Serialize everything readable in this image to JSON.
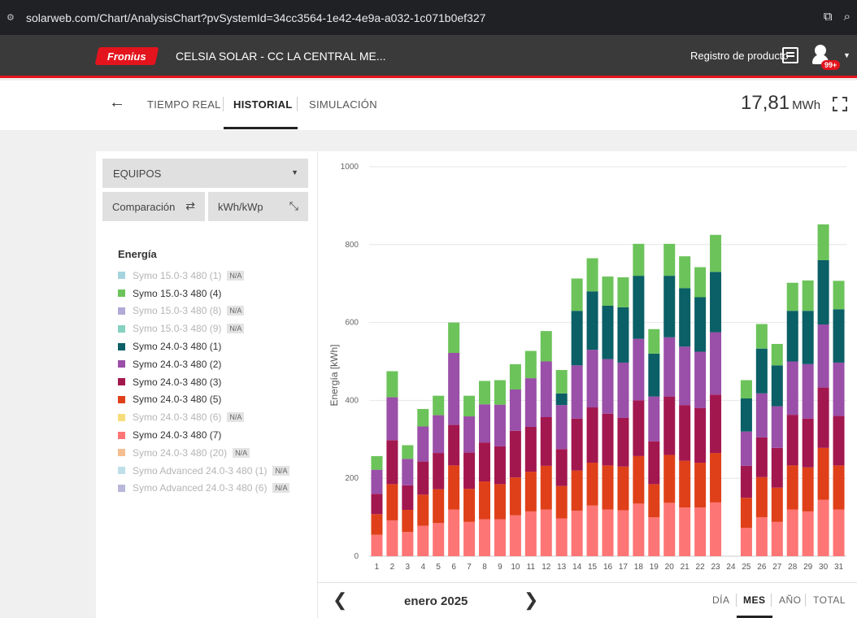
{
  "browser": {
    "site_icon": "site-info-icon",
    "url": "solarweb.com/Chart/AnalysisChart?pvSystemId=34cc3564-1e42-4e9a-a032-1c071b0ef327"
  },
  "header": {
    "logo_text": "Fronius",
    "title": "CELSIA SOLAR - CC LA CENTRAL ME...",
    "registro": "Registro de producto",
    "badge": "99+",
    "accent_color": "#e3141d"
  },
  "nav": {
    "tabs": [
      {
        "label": "TIEMPO REAL",
        "active": false
      },
      {
        "label": "HISTORIAL",
        "active": true
      },
      {
        "label": "SIMULACIÓN",
        "active": false
      }
    ],
    "total_value": "17,81",
    "total_unit": "MWh"
  },
  "controls": {
    "equipos": "EQUIPOS",
    "comparacion": "Comparación",
    "normalizacion": "kWh/kWp"
  },
  "legend": {
    "title": "Energía",
    "items": [
      {
        "label": "Symo 15.0-3 480 (1)",
        "color": "#a6d4de",
        "disabled": true,
        "na": "N/A"
      },
      {
        "label": "Symo 15.0-3 480 (4)",
        "color": "#6cc35a",
        "disabled": false,
        "na": ""
      },
      {
        "label": "Symo 15.0-3 480 (8)",
        "color": "#b3a9d6",
        "disabled": true,
        "na": "N/A"
      },
      {
        "label": "Symo 15.0-3 480 (9)",
        "color": "#86d1bf",
        "disabled": true,
        "na": "N/A"
      },
      {
        "label": "Symo 24.0-3 480 (1)",
        "color": "#0b5f66",
        "disabled": false,
        "na": ""
      },
      {
        "label": "Symo 24.0-3 480 (2)",
        "color": "#9a4fa8",
        "disabled": false,
        "na": ""
      },
      {
        "label": "Symo 24.0-3 480 (3)",
        "color": "#a3174f",
        "disabled": false,
        "na": ""
      },
      {
        "label": "Symo 24.0-3 480 (5)",
        "color": "#df4019",
        "disabled": false,
        "na": ""
      },
      {
        "label": "Symo 24.0-3 480 (6)",
        "color": "#f7dc7a",
        "disabled": true,
        "na": "N/A"
      },
      {
        "label": "Symo 24.0-3 480 (7)",
        "color": "#fd7575",
        "disabled": false,
        "na": ""
      },
      {
        "label": "Symo 24.0-3 480 (20)",
        "color": "#f5be8f",
        "disabled": true,
        "na": "N/A"
      },
      {
        "label": "Symo Advanced 24.0-3 480 (1)",
        "color": "#bfdfe9",
        "disabled": true,
        "na": "N/A"
      },
      {
        "label": "Symo Advanced 24.0-3 480 (6)",
        "color": "#b9b8da",
        "disabled": true,
        "na": "N/A"
      }
    ]
  },
  "footer": {
    "month": "enero 2025",
    "periods": [
      {
        "label": "DÍA",
        "active": false
      },
      {
        "label": "MES",
        "active": true
      },
      {
        "label": "AÑO",
        "active": false
      },
      {
        "label": "TOTAL",
        "active": false
      }
    ]
  },
  "chart_data": {
    "type": "bar",
    "stacked": true,
    "ylabel": "Energía [kWh]",
    "ylim": [
      0,
      1000
    ],
    "yticks": [
      0,
      200,
      400,
      600,
      800,
      1000
    ],
    "grid": true,
    "categories": [
      "1",
      "2",
      "3",
      "4",
      "5",
      "6",
      "7",
      "8",
      "9",
      "10",
      "11",
      "12",
      "13",
      "14",
      "15",
      "16",
      "17",
      "18",
      "19",
      "20",
      "21",
      "22",
      "23",
      "24",
      "25",
      "26",
      "27",
      "28",
      "29",
      "30",
      "31"
    ],
    "series": [
      {
        "name": "Symo 24.0-3 480 (7)",
        "color": "#fd7575",
        "values": [
          55,
          92,
          62,
          78,
          85,
          120,
          88,
          95,
          95,
          105,
          115,
          120,
          97,
          117,
          130,
          120,
          118,
          135,
          100,
          137,
          125,
          125,
          138,
          0,
          73,
          100,
          88,
          120,
          115,
          145,
          120
        ]
      },
      {
        "name": "Symo 24.0-3 480 (5)",
        "color": "#df4019",
        "values": [
          53,
          93,
          57,
          80,
          87,
          113,
          85,
          97,
          90,
          97,
          102,
          112,
          83,
          103,
          110,
          113,
          112,
          122,
          85,
          123,
          120,
          115,
          127,
          0,
          77,
          103,
          88,
          113,
          113,
          133,
          113
        ]
      },
      {
        "name": "Symo 24.0-3 480 (3)",
        "color": "#a3174f",
        "values": [
          52,
          113,
          63,
          85,
          93,
          104,
          93,
          100,
          97,
          120,
          115,
          125,
          95,
          133,
          142,
          133,
          125,
          143,
          110,
          150,
          143,
          140,
          150,
          0,
          82,
          102,
          102,
          130,
          125,
          155,
          127
        ]
      },
      {
        "name": "Symo 24.0-3 480 (2)",
        "color": "#9a4fa8",
        "values": [
          62,
          110,
          68,
          90,
          97,
          185,
          93,
          98,
          107,
          106,
          125,
          143,
          113,
          137,
          148,
          140,
          142,
          158,
          115,
          152,
          150,
          145,
          160,
          0,
          88,
          113,
          107,
          137,
          140,
          162,
          137
        ]
      },
      {
        "name": "Symo 24.0-3 480 (1)",
        "color": "#0b5f66",
        "values": [
          0,
          0,
          0,
          0,
          0,
          0,
          0,
          0,
          0,
          0,
          0,
          0,
          30,
          140,
          150,
          137,
          142,
          162,
          110,
          158,
          150,
          140,
          155,
          0,
          85,
          115,
          105,
          130,
          137,
          165,
          137
        ]
      },
      {
        "name": "Symo 15.0-3 480 (4)",
        "color": "#6cc35a",
        "values": [
          35,
          67,
          35,
          45,
          50,
          78,
          53,
          60,
          63,
          65,
          70,
          78,
          60,
          83,
          85,
          75,
          77,
          82,
          63,
          82,
          82,
          77,
          95,
          0,
          47,
          63,
          55,
          72,
          78,
          92,
          73
        ]
      }
    ]
  }
}
